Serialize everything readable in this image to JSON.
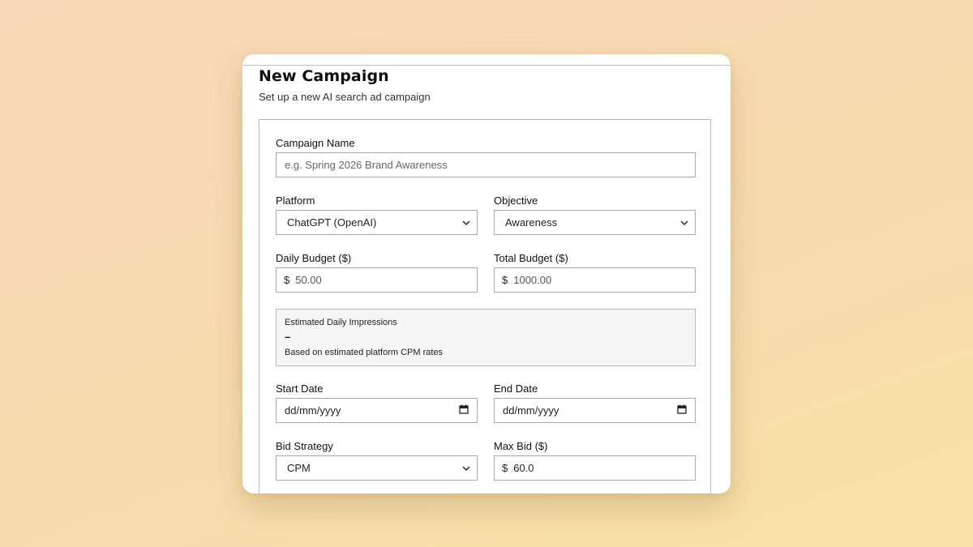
{
  "header": {
    "title": "New Campaign",
    "subtitle": "Set up a new AI search ad campaign"
  },
  "form": {
    "campaign_name": {
      "label": "Campaign Name",
      "placeholder": "e.g. Spring 2026 Brand Awareness",
      "value": ""
    },
    "platform": {
      "label": "Platform",
      "selected": "ChatGPT (OpenAI)"
    },
    "objective": {
      "label": "Objective",
      "selected": "Awareness"
    },
    "daily_budget": {
      "label": "Daily Budget ($)",
      "currency": "$",
      "value": "50.00"
    },
    "total_budget": {
      "label": "Total Budget ($)",
      "currency": "$",
      "value": "1000.00"
    },
    "estimate": {
      "title": "Estimated Daily Impressions",
      "value": "–",
      "note": "Based on estimated platform CPM rates"
    },
    "start_date": {
      "label": "Start Date",
      "placeholder": "dd/mm/yyyy"
    },
    "end_date": {
      "label": "End Date",
      "placeholder": "dd/mm/yyyy"
    },
    "bid_strategy": {
      "label": "Bid Strategy",
      "selected": "CPM"
    },
    "max_bid": {
      "label": "Max Bid ($)",
      "currency": "$",
      "value": "60.0"
    }
  },
  "icons": {
    "dropdown": "chevron-down-icon",
    "calendar": "calendar-icon"
  }
}
